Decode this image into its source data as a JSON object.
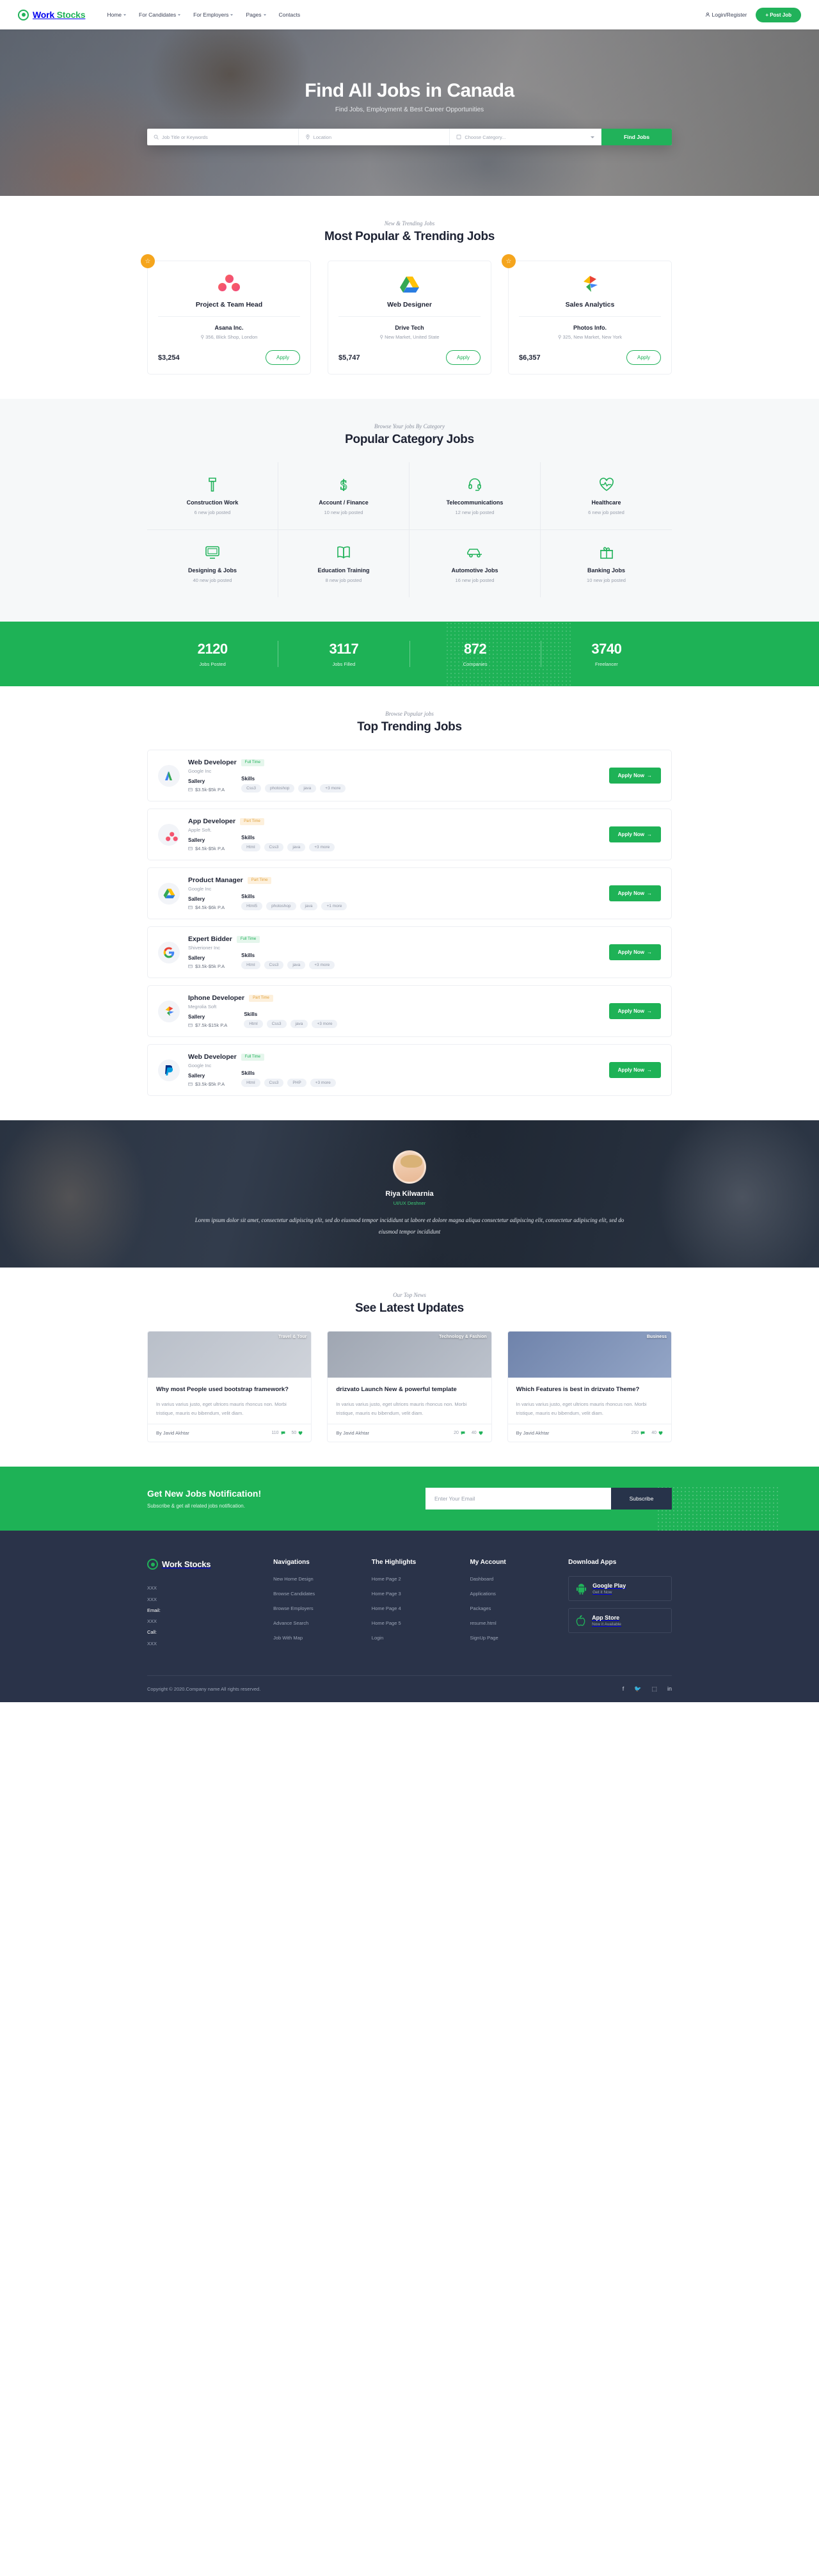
{
  "header": {
    "brand_a": "Work ",
    "brand_b": "Stocks",
    "nav": [
      {
        "label": "Home",
        "caret": true
      },
      {
        "label": "For Candidates",
        "caret": true
      },
      {
        "label": "For Employers",
        "caret": true
      },
      {
        "label": "Pages",
        "caret": true
      },
      {
        "label": "Contacts",
        "caret": false
      }
    ],
    "login_label": "Login/Register",
    "post_job_label": "+ Post Job"
  },
  "hero": {
    "title": "Find All Jobs in Canada",
    "subtitle": "Find Jobs, Employment & Best Career Opportunities",
    "search": {
      "keyword_placeholder": "Job Title or Keywords",
      "location_placeholder": "Location",
      "category_placeholder": "Choose Category...",
      "button_label": "Find Jobs"
    }
  },
  "popular": {
    "eyebrow": "New & Trending Jobs",
    "title": "Most Popular & Trending Jobs",
    "apply_label": "Apply",
    "cards": [
      {
        "featured": true,
        "logo": "asana-logo",
        "title": "Project & Team Head",
        "company": "Asana Inc.",
        "location": "356, Blick Shop, London",
        "salary": "$3,254"
      },
      {
        "featured": false,
        "logo": "google-drive-logo",
        "title": "Web Designer",
        "company": "Drive Tech",
        "location": "New Market, United State",
        "salary": "$5,747"
      },
      {
        "featured": true,
        "logo": "google-photos-logo",
        "title": "Sales Analytics",
        "company": "Photos Info.",
        "location": "325, New Market, New York",
        "salary": "$6,357"
      }
    ]
  },
  "categories": {
    "eyebrow": "Browse Your jobs By Category",
    "title": "Popular Category Jobs",
    "items": [
      {
        "icon": "hammer-icon",
        "label": "Construction Work",
        "count": "6 new job posted"
      },
      {
        "icon": "dollar-icon",
        "label": "Account / Finance",
        "count": "10 new job posted"
      },
      {
        "icon": "headset-icon",
        "label": "Telecommunications",
        "count": "12 new job posted"
      },
      {
        "icon": "heartbeat-icon",
        "label": "Healthcare",
        "count": "6 new job posted"
      },
      {
        "icon": "monitor-icon",
        "label": "Designing & Jobs",
        "count": "40 new job posted"
      },
      {
        "icon": "book-icon",
        "label": "Education Training",
        "count": "8 new job posted"
      },
      {
        "icon": "car-icon",
        "label": "Automotive Jobs",
        "count": "16 new job posted"
      },
      {
        "icon": "gift-icon",
        "label": "Banking Jobs",
        "count": "10 new job posted"
      }
    ]
  },
  "stats": [
    {
      "number": "2120",
      "label": "Jobs Posted"
    },
    {
      "number": "3117",
      "label": "Jobs Filled"
    },
    {
      "number": "872",
      "label": "Companies"
    },
    {
      "number": "3740",
      "label": "Freelancer"
    }
  ],
  "trending": {
    "eyebrow": "Browse Popular jobs",
    "title": "Top Trending Jobs",
    "salary_heading": "Sallery",
    "skills_heading": "Skills",
    "apply_label": "Apply Now",
    "jobs": [
      {
        "logo": "google-ads-logo",
        "title": "Web Developer",
        "type": "Full Time",
        "type_kind": "full",
        "company": "Google Inc",
        "salary": "$3.5k-$5k P.A",
        "skills": [
          "Css3",
          "photoshop",
          "java",
          "+3 more"
        ]
      },
      {
        "logo": "asana-logo",
        "title": "App Developer",
        "type": "Part Time",
        "type_kind": "part",
        "company": "Apple Soft.",
        "salary": "$4.5k-$5k P.A",
        "skills": [
          "Html",
          "Css3",
          "java",
          "+3 more"
        ]
      },
      {
        "logo": "google-drive-logo",
        "title": "Product Manager",
        "type": "Part Time",
        "type_kind": "part",
        "company": "Google Inc",
        "salary": "$4.5k-$6k P.A",
        "skills": [
          "Html5",
          "photoshop",
          "java",
          "+1 more"
        ]
      },
      {
        "logo": "google-g-logo",
        "title": "Expert Bidder",
        "type": "Full Time",
        "type_kind": "full",
        "company": "Shiverioner Inc",
        "salary": "$3.5k-$5k P.A",
        "skills": [
          "Html",
          "Css3",
          "java",
          "+3 more"
        ]
      },
      {
        "logo": "google-photos-logo",
        "title": "Iphone Developer",
        "type": "Part Time",
        "type_kind": "part",
        "company": "Megrolia Soft",
        "salary": "$7.5k-$15k P.A",
        "skills": [
          "Html",
          "Css3",
          "java",
          "+3 more"
        ]
      },
      {
        "logo": "paypal-logo",
        "title": "Web Developer",
        "type": "Full Time",
        "type_kind": "full",
        "company": "Google Inc",
        "salary": "$3.5k-$5k P.A",
        "skills": [
          "Html",
          "Css3",
          "PHP",
          "+3 more"
        ]
      }
    ]
  },
  "testimonial": {
    "name": "Riya Kilwarnia",
    "role": "UI/UX Deshner",
    "quote": "Lorem ipsum dolor sit amet, consectetur adipiscing elit, sed do eiusmod tempor incididunt ut labore et dolore magna aliqua consectetur adipiscing elit, consectetur adipiscing elit, sed do eiusmod tempor incididunt"
  },
  "blog": {
    "eyebrow": "Our Top News",
    "title": "See Latest Updates",
    "posts": [
      {
        "category": "Travel & Tour",
        "title": "Why most People used bootstrap framework?",
        "excerpt": "In varius varius justo, eget ultrices mauris rhoncus non. Morbi tristique, mauris eu bibendum, velit diam.",
        "author": "By Javid Akhtar",
        "comments": "110",
        "likes": "50"
      },
      {
        "category": "Technology & Fashion",
        "title": "drizvato Launch New & powerful template",
        "excerpt": "In varius varius justo, eget ultrices mauris rhoncus non. Morbi tristique, mauris eu bibendum, velit diam.",
        "author": "By Javid Akhtar",
        "comments": "20",
        "likes": "40"
      },
      {
        "category": "Business",
        "title": "Which Features is best in drizvato Theme?",
        "excerpt": "In varius varius justo, eget ultrices mauris rhoncus non. Morbi tristique, mauris eu bibendum, velit diam.",
        "author": "By Javid Akhtar",
        "comments": "250",
        "likes": "40"
      }
    ]
  },
  "newsletter": {
    "title": "Get New Jobs Notification!",
    "subtitle": "Subscribe & get all related jobs notification.",
    "email_placeholder": "Enter Your Email",
    "button_label": "Subscribe"
  },
  "footer": {
    "brand_a": "Work ",
    "brand_b": "Stocks",
    "contact": [
      {
        "label": "",
        "value": "XXX"
      },
      {
        "label": "",
        "value": "XXX"
      },
      {
        "label": "Email:",
        "value": "XXX"
      },
      {
        "label": "Call:",
        "value": "XXX"
      }
    ],
    "columns": [
      {
        "heading": "Navigations",
        "links": [
          "New Home Design",
          "Browse Candidates",
          "Browse Employers",
          "Advance Search",
          "Job With Map"
        ]
      },
      {
        "heading": "The Highlights",
        "links": [
          "Home Page 2",
          "Home Page 3",
          "Home Page 4",
          "Home Page 5",
          "Login"
        ]
      },
      {
        "heading": "My Account",
        "links": [
          "Dashboard",
          "Applications",
          "Packages",
          "resume.html",
          "SignUp Page"
        ]
      }
    ],
    "apps_heading": "Download Apps",
    "apps": [
      {
        "icon": "android-icon",
        "name": "Google Play",
        "sub": "Get it Now"
      },
      {
        "icon": "apple-icon",
        "name": "App Store",
        "sub": "Now it Available"
      }
    ],
    "copyright": "Copyright © 2020.Company name All rights reserved.",
    "social": [
      "f",
      "t",
      "ig",
      "in"
    ]
  },
  "colors": {
    "brand_green": "#21b25a",
    "stats_green": "#1eb256",
    "footer_navy": "#2a3349",
    "badge_orange": "#f5a51d"
  }
}
